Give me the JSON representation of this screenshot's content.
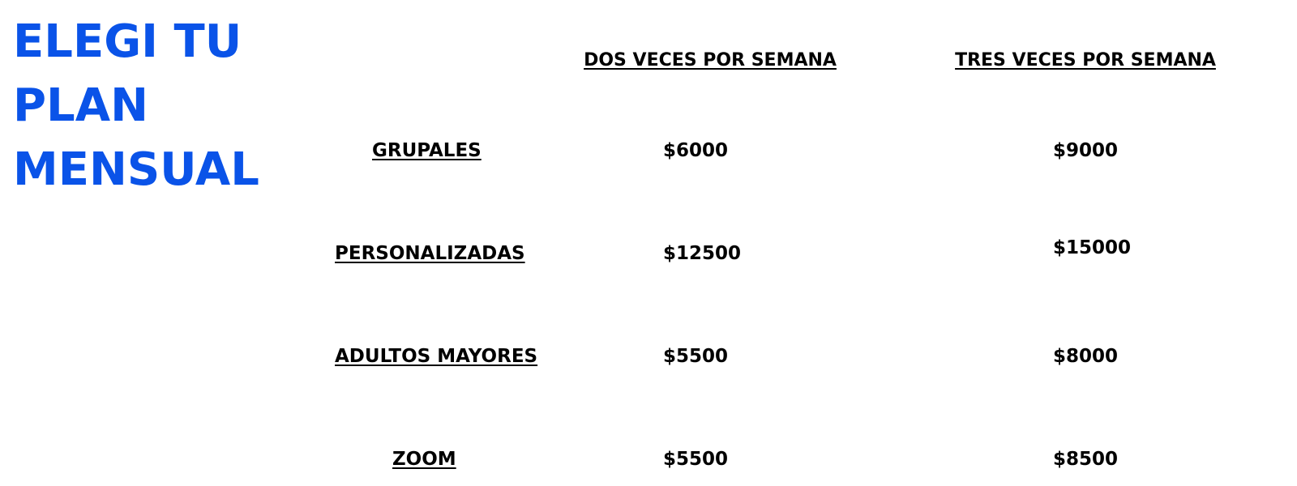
{
  "title": {
    "lines": [
      "ELEGI TU",
      "PLAN",
      "MENSUAL"
    ],
    "color": "#0a53e8"
  },
  "columns": [
    "DOS VECES POR SEMANA",
    "TRES VECES POR SEMANA"
  ],
  "rows": [
    {
      "label": "GRUPALES",
      "dos": "$6000",
      "tres": "$9000"
    },
    {
      "label": "PERSONALIZADAS",
      "dos": "$12500",
      "tres": "$15000"
    },
    {
      "label": "ADULTOS MAYORES",
      "dos": "$5500",
      "tres": "$8000"
    },
    {
      "label": "ZOOM",
      "dos": "$5500",
      "tres": "$8500"
    }
  ]
}
